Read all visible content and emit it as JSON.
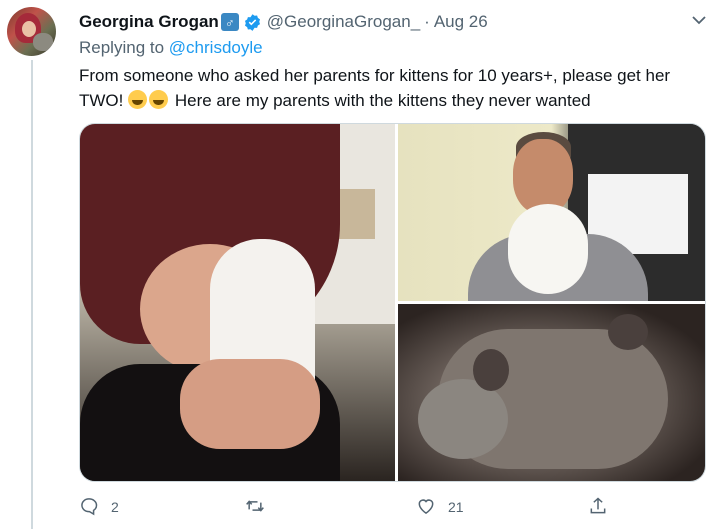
{
  "author": {
    "display_name": "Georgina Grogan",
    "badge_emoji": "male-sign-emoji",
    "handle": "@GeorginaGrogan_",
    "separator": "·",
    "date": "Aug 26",
    "verified": true
  },
  "reply": {
    "prefix": "Replying to",
    "mention": "@chrisdoyle"
  },
  "tweet": {
    "text_before_emoji": "From someone who asked her parents for kittens for 10 years+, please get her TWO!",
    "emoji": "laughing-tears-emoji",
    "emoji_count": 2,
    "text_after_emoji": "Here are my parents with the kittens they never wanted"
  },
  "media": {
    "photo_count": 3,
    "photos": [
      {
        "name": "photo-woman-with-white-kitten"
      },
      {
        "name": "photo-man-with-white-kitten"
      },
      {
        "name": "photo-grey-kitten-lying"
      }
    ]
  },
  "actions": {
    "reply_count": "2",
    "retweet_count": "",
    "like_count": "21"
  },
  "colors": {
    "accent": "#1d9bf0",
    "secondary_text": "#536471",
    "primary_text": "#0f1419",
    "thread_line": "#cfd9de"
  },
  "icons": [
    "avatar",
    "verified-icon",
    "chevron-down-icon",
    "reply-icon",
    "retweet-icon",
    "like-icon",
    "share-icon"
  ]
}
